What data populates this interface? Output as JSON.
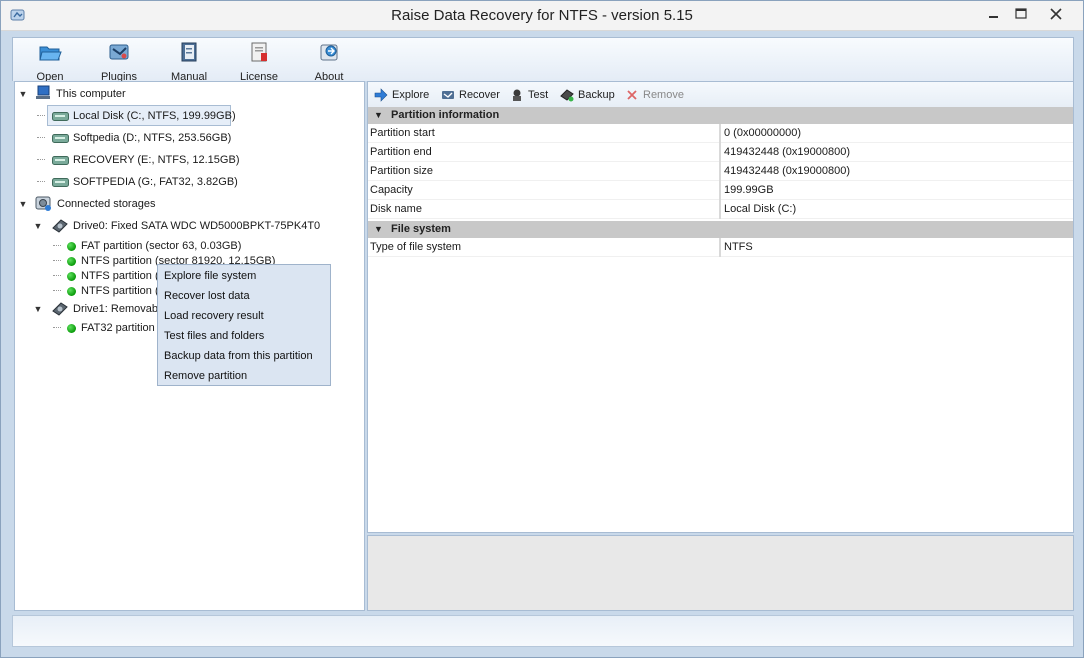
{
  "window": {
    "title": "Raise Data Recovery for NTFS - version 5.15"
  },
  "toolbar": {
    "buttons": [
      {
        "label": "Open",
        "icon": "folder-open-icon"
      },
      {
        "label": "Plugins",
        "icon": "plugins-icon"
      },
      {
        "label": "Manual",
        "icon": "manual-book-icon"
      },
      {
        "label": "License",
        "icon": "license-icon"
      },
      {
        "label": "About",
        "icon": "about-icon"
      }
    ]
  },
  "tree": {
    "this_computer": "This computer",
    "disks": [
      {
        "label": "Local Disk (C:, NTFS, 199.99GB)",
        "selected": true
      },
      {
        "label": "Softpedia (D:, NTFS, 253.56GB)"
      },
      {
        "label": "RECOVERY (E:, NTFS, 12.15GB)"
      },
      {
        "label": "SOFTPEDIA (G:, FAT32, 3.82GB)"
      }
    ],
    "connected_storages": "Connected storages",
    "drive0": {
      "label": "Drive0: Fixed SATA WDC WD5000BPKT-75PK4T0",
      "partitions": [
        "FAT partition (sector 63, 0.03GB)",
        "NTFS partition (sector 81920, 12.15GB)",
        "NTFS partition (s",
        "NTFS partition (s"
      ]
    },
    "drive1": {
      "label": "Drive1: Removabl",
      "partitions": [
        "FAT32 partition"
      ]
    }
  },
  "context_menu": {
    "items": [
      "Explore file system",
      "Recover lost data",
      "Load recovery result",
      "Test files and folders",
      "Backup data from this partition",
      "Remove partition"
    ]
  },
  "actions": [
    {
      "label": "Explore",
      "icon": "arrow-right-icon",
      "enabled": true
    },
    {
      "label": "Recover",
      "icon": "recover-icon",
      "enabled": true
    },
    {
      "label": "Test",
      "icon": "test-icon",
      "enabled": true
    },
    {
      "label": "Backup",
      "icon": "backup-icon",
      "enabled": true
    },
    {
      "label": "Remove",
      "icon": "remove-x-icon",
      "enabled": false
    }
  ],
  "partition_info": {
    "header": "Partition information",
    "rows": [
      {
        "key": "Partition start",
        "value": "0 (0x00000000)"
      },
      {
        "key": "Partition end",
        "value": "419432448 (0x19000800)"
      },
      {
        "key": "Partition size",
        "value": "419432448 (0x19000800)"
      },
      {
        "key": "Capacity",
        "value": "199.99GB"
      },
      {
        "key": "Disk name",
        "value": "Local Disk (C:)"
      }
    ]
  },
  "file_system": {
    "header": "File system",
    "rows": [
      {
        "key": "Type of file system",
        "value": "NTFS"
      }
    ]
  },
  "colors": {
    "frame": "#c9d9ea",
    "section_header": "#c8c8c8",
    "context_menu_bg": "#dbe5f2",
    "partition_ok": "#0a9a0a"
  }
}
